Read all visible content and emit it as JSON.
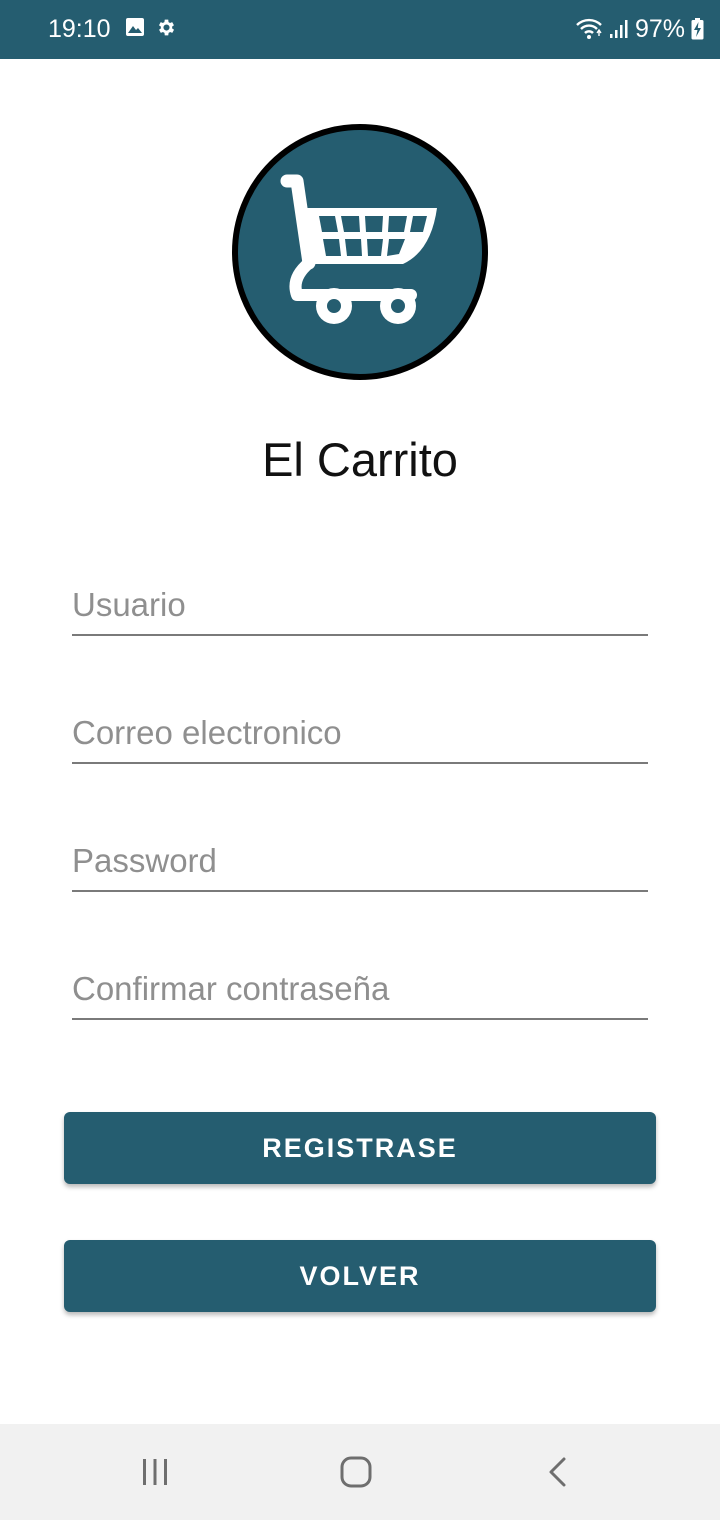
{
  "status_bar": {
    "time": "19:10",
    "battery": "97%",
    "icons": [
      "image-icon",
      "gear-icon",
      "wifi-icon",
      "signal-icon",
      "battery-charging-icon"
    ]
  },
  "app": {
    "logo_icon": "shopping-cart-icon",
    "title": "El Carrito"
  },
  "form": {
    "username_placeholder": "Usuario",
    "email_placeholder": "Correo electronico",
    "password_placeholder": "Password",
    "confirm_password_placeholder": "Confirmar contraseña"
  },
  "buttons": {
    "register_label": "REGISTRASE",
    "back_label": "VOLVER"
  },
  "colors": {
    "primary": "#255d70",
    "nav_background": "#f1f1f1"
  },
  "nav_bar": {
    "icons": [
      "recent-apps-icon",
      "home-icon",
      "back-icon"
    ]
  }
}
